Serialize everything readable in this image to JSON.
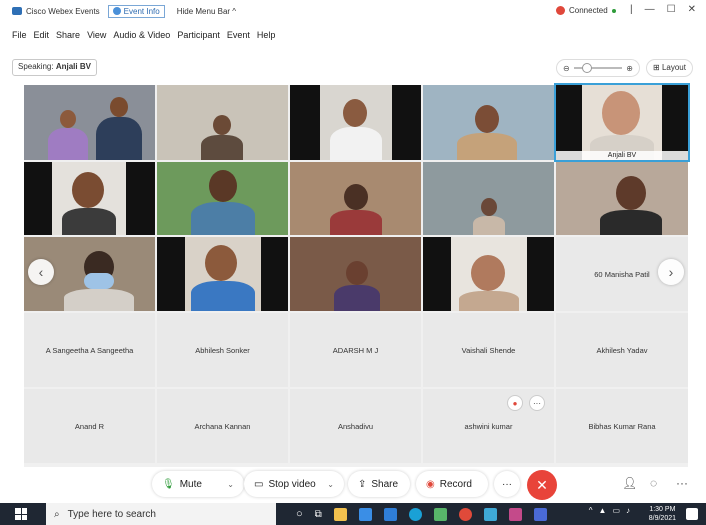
{
  "titlebar": {
    "app_title": "Cisco Webex Events",
    "event_info": "Event Info",
    "hide_menu": "Hide Menu Bar ^",
    "connected": "Connected",
    "win_controls": [
      "|",
      "—",
      "☐",
      "✕"
    ]
  },
  "menubar": [
    "File",
    "Edit",
    "Share",
    "View",
    "Audio & Video",
    "Participant",
    "Event",
    "Help"
  ],
  "speaking": {
    "label": "Speaking:",
    "name": "Anjali BV"
  },
  "layout_label": "Layout",
  "zoom": {
    "minus": "⊖",
    "plus": "⊕"
  },
  "active_tile_name": "Anjali BV",
  "name_tiles": {
    "row3_col5": "60 Manisha Patil",
    "row4": [
      "A Sangeetha A Sangeetha",
      "Abhilesh Sonker",
      "ADARSH M J",
      "Vaishali Shende",
      "Akhilesh Yadav"
    ],
    "row5": [
      "Anand R",
      "Archana Kannan",
      "Anshadivu",
      "ashwini kumar",
      "Bibhas Kumar Rana"
    ]
  },
  "controls": {
    "mute": "Mute",
    "stop_video": "Stop video",
    "share": "Share",
    "record": "Record",
    "more": "···",
    "leave": "✕"
  },
  "taskbar": {
    "search_placeholder": "Type here to search",
    "time": "1:30 PM",
    "date": "8/9/2021"
  },
  "colors": {
    "accent": "#3aa0d8",
    "leave": "#e8443a",
    "taskbar": "#1f2733"
  }
}
